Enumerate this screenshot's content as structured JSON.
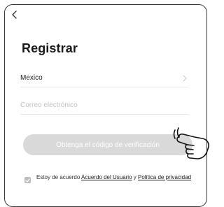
{
  "nav": {
    "back_label": "<"
  },
  "page": {
    "title": "Registrar"
  },
  "form": {
    "country_value": "Mexico",
    "email_placeholder": "Correo electrónico",
    "email_value": ""
  },
  "actions": {
    "get_code_label": "Obtenga el código de verificación"
  },
  "agreement": {
    "prefix": "Estoy de acuerdo ",
    "user_agreement_link": "Acuerdo del Usuario",
    "conjunction": " y ",
    "privacy_policy_link": "Política de privacidad",
    "checked": true
  },
  "colors": {
    "button_disabled": "#d9d9d9",
    "text_primary": "#1a1a1a",
    "placeholder": "#c2c2c2"
  },
  "icons": [
    "chevron-left-icon",
    "chevron-right-icon",
    "checkmark-icon",
    "pointing-hand-icon"
  ]
}
